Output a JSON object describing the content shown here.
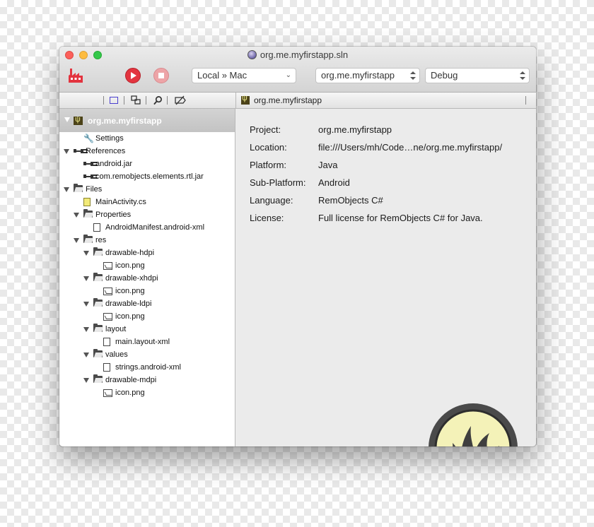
{
  "window": {
    "title": "org.me.myfirstapp.sln"
  },
  "toolbar": {
    "build_icon": "build-factory-icon",
    "run_icon": "play-icon",
    "stop_icon": "stop-icon",
    "target_select": "Local » Mac",
    "project_select": "org.me.myfirstapp",
    "config_select": "Debug"
  },
  "navigator_icons": [
    "project-view-icon",
    "hierarchy-icon",
    "search-icon",
    "breakpoints-icon"
  ],
  "editor_tab": {
    "label": "org.me.myfirstapp"
  },
  "sidebar": {
    "project_name": "org.me.myfirstapp",
    "tree": [
      {
        "label": "Settings",
        "icon": "wrench-icon",
        "level": 1,
        "expanded": null
      },
      {
        "label": "References",
        "icon": "reference-icon",
        "level": 0,
        "expanded": true
      },
      {
        "label": "android.jar",
        "icon": "reference-icon",
        "level": 1,
        "expanded": null
      },
      {
        "label": "com.remobjects.elements.rtl.jar",
        "icon": "reference-icon",
        "level": 1,
        "expanded": null
      },
      {
        "label": "Files",
        "icon": "folder-icon",
        "level": 0,
        "expanded": true
      },
      {
        "label": "MainActivity.cs",
        "icon": "cs-file-icon",
        "level": 1,
        "expanded": null
      },
      {
        "label": "Properties",
        "icon": "folder-icon",
        "level": 1,
        "expanded": true
      },
      {
        "label": "AndroidManifest.android-xml",
        "icon": "file-icon",
        "level": 2,
        "expanded": null
      },
      {
        "label": "res",
        "icon": "folder-icon",
        "level": 1,
        "expanded": true
      },
      {
        "label": "drawable-hdpi",
        "icon": "folder-icon",
        "level": 2,
        "expanded": true
      },
      {
        "label": "icon.png",
        "icon": "image-icon",
        "level": 3,
        "expanded": null
      },
      {
        "label": "drawable-xhdpi",
        "icon": "folder-icon",
        "level": 2,
        "expanded": true
      },
      {
        "label": "icon.png",
        "icon": "image-icon",
        "level": 3,
        "expanded": null
      },
      {
        "label": "drawable-ldpi",
        "icon": "folder-icon",
        "level": 2,
        "expanded": true
      },
      {
        "label": "icon.png",
        "icon": "image-icon",
        "level": 3,
        "expanded": null
      },
      {
        "label": "layout",
        "icon": "folder-icon",
        "level": 2,
        "expanded": true
      },
      {
        "label": "main.layout-xml",
        "icon": "file-icon",
        "level": 3,
        "expanded": null
      },
      {
        "label": "values",
        "icon": "folder-icon",
        "level": 2,
        "expanded": true
      },
      {
        "label": "strings.android-xml",
        "icon": "file-icon",
        "level": 3,
        "expanded": null
      },
      {
        "label": "drawable-mdpi",
        "icon": "folder-icon",
        "level": 2,
        "expanded": true
      },
      {
        "label": "icon.png",
        "icon": "image-icon",
        "level": 3,
        "expanded": null
      }
    ]
  },
  "details": {
    "properties": [
      {
        "key": "Project:",
        "value": "org.me.myfirstapp"
      },
      {
        "key": "Location:",
        "value": "file:///Users/mh/Code…ne/org.me.myfirstapp/"
      },
      {
        "key": "Platform:",
        "value": "Java"
      },
      {
        "key": "Sub-Platform:",
        "value": "Android"
      },
      {
        "key": "Language:",
        "value": "RemObjects C#"
      },
      {
        "key": "License:",
        "value": "Full license for RemObjects C# for Java."
      }
    ],
    "logo_icon": "remobjects-flame-logo-icon"
  },
  "colors": {
    "accent_red": "#e3343f",
    "sidebar_selected": "#c8c8c8",
    "logo_yellow": "#f4f2b8"
  }
}
